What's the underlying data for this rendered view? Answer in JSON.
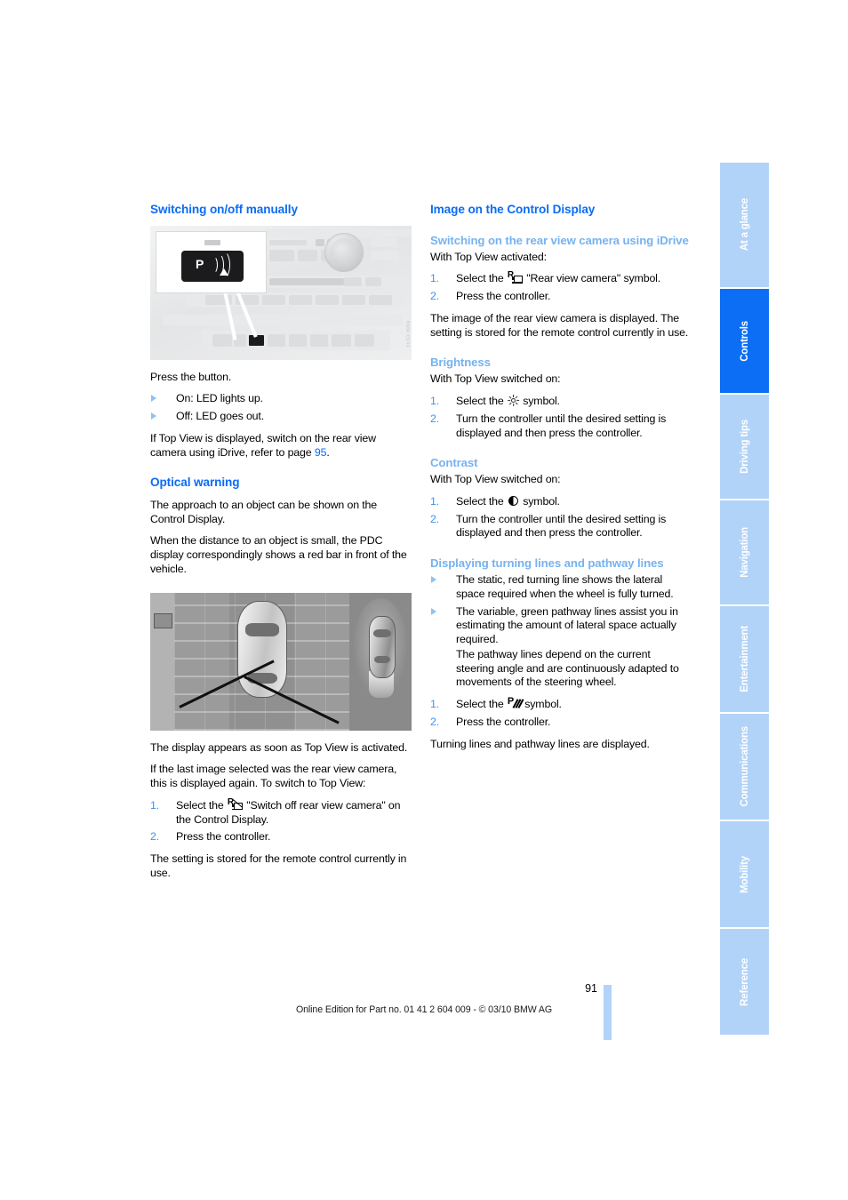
{
  "document": {
    "page_number": "91",
    "footer": "Online Edition for Part no. 01 41 2 604 009 - © 03/10 BMW AG"
  },
  "side_tabs": [
    {
      "label": "At a glance",
      "active": false
    },
    {
      "label": "Controls",
      "active": true
    },
    {
      "label": "Driving tips",
      "active": false
    },
    {
      "label": "Navigation",
      "active": false
    },
    {
      "label": "Entertainment",
      "active": false
    },
    {
      "label": "Communications",
      "active": false
    },
    {
      "label": "Mobility",
      "active": false
    },
    {
      "label": "Reference",
      "active": false
    }
  ],
  "colors": {
    "heading_blue": "#0a6cf5",
    "subheading_blue": "#76b2f0",
    "tab_inactive": "#b2d3f8",
    "tab_active": "#0b6ef4",
    "list_marker_blue": "#3b93f2"
  },
  "left_column": {
    "heading": "Switching on/off manually",
    "figure_console": {
      "caption_alt": "Center console with PDC button callout",
      "button_label": "P",
      "watermark": "BMW X5/X6"
    },
    "press_button": "Press the button.",
    "bullets": [
      "On: LED lights up.",
      "Off: LED goes out."
    ],
    "topview_note_part1": "If Top View is displayed, switch on the rear view camera using iDrive, refer to page ",
    "topview_note_pageref": "95",
    "topview_note_part2": ".",
    "optical_warning": {
      "heading": "Optical warning",
      "para1": "The approach to an object can be shown on the Control Display.",
      "para2": "When the distance to an object is small, the PDC display correspondingly shows a red bar in front of the vehicle."
    },
    "figure_topview": {
      "caption_alt": "Top View display showing vehicle from above with pathway lines"
    },
    "after_figure": {
      "para1": "The display appears as soon as Top View is activated.",
      "para2": "If the last image selected was the rear view camera, this is displayed again. To switch to Top View:",
      "steps": [
        {
          "num": "1.",
          "pre": "Select the ",
          "icon": "rear-view-camera-off-icon",
          "post": "\"Switch off rear view camera\" on the Control Display."
        },
        {
          "num": "2.",
          "pre": "Press the controller.",
          "icon": "",
          "post": ""
        }
      ],
      "para3": "The setting is stored for the remote control currently in use."
    }
  },
  "right_column": {
    "heading": "Image on the Control Display",
    "rear_view_camera": {
      "subheading": "Switching on the rear view camera using iDrive",
      "intro": "With Top View activated:",
      "steps": [
        {
          "num": "1.",
          "pre": "Select the ",
          "icon": "rear-view-camera-icon",
          "post": "\"Rear view camera\" symbol."
        },
        {
          "num": "2.",
          "pre": "Press the controller.",
          "icon": "",
          "post": ""
        }
      ],
      "outro": "The image of the rear view camera is displayed. The setting is stored for the remote control currently in use."
    },
    "brightness": {
      "subheading": "Brightness",
      "intro": "With Top View switched on:",
      "steps": [
        {
          "num": "1.",
          "pre": "Select the ",
          "icon": "brightness-sun-icon",
          "post": "symbol."
        },
        {
          "num": "2.",
          "pre": "Turn the controller until the desired setting is displayed and then press the controller.",
          "icon": "",
          "post": ""
        }
      ]
    },
    "contrast": {
      "subheading": "Contrast",
      "intro": "With Top View switched on:",
      "steps": [
        {
          "num": "1.",
          "pre": "Select the ",
          "icon": "contrast-icon",
          "post": "symbol."
        },
        {
          "num": "2.",
          "pre": "Turn the controller until the desired setting is displayed and then press the controller.",
          "icon": "",
          "post": ""
        }
      ]
    },
    "turning_lines": {
      "subheading": "Displaying turning lines and pathway lines",
      "bullets": [
        "The static, red turning line shows the lateral space required when the wheel is fully turned.",
        "The variable, green pathway lines assist you in estimating the amount of lateral space actually required."
      ],
      "bullet2_sub": "The pathway lines depend on the current steering angle and are continuously adapted to movements of the steering wheel.",
      "steps": [
        {
          "num": "1.",
          "pre": "Select the ",
          "icon": "pathway-lines-icon",
          "post": "symbol."
        },
        {
          "num": "2.",
          "pre": "Press the controller.",
          "icon": "",
          "post": ""
        }
      ],
      "outro": "Turning lines and pathway lines are displayed."
    }
  }
}
